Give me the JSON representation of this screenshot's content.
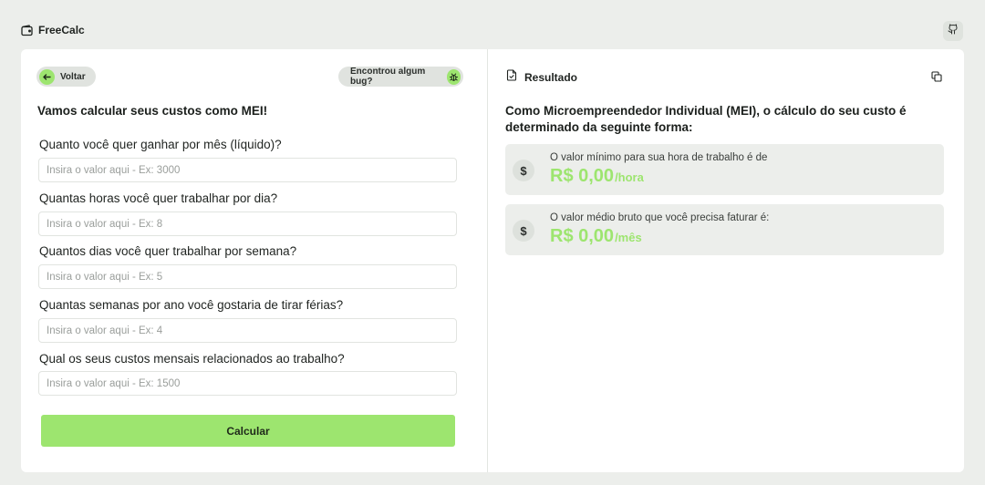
{
  "app": {
    "name": "FreeCalc"
  },
  "form": {
    "back_label": "Voltar",
    "bug_label": "Encontrou algum bug?",
    "title": "Vamos calcular seus custos como MEI!",
    "fields": [
      {
        "label": "Quanto você quer ganhar por mês (líquido)?",
        "placeholder": "Insira o valor aqui - Ex: 3000",
        "value": ""
      },
      {
        "label": "Quantas horas você quer trabalhar por dia?",
        "placeholder": "Insira o valor aqui - Ex: 8",
        "value": ""
      },
      {
        "label": "Quantos dias você quer trabalhar por semana?",
        "placeholder": "Insira o valor aqui - Ex: 5",
        "value": ""
      },
      {
        "label": "Quantas semanas por ano você gostaria de tirar férias?",
        "placeholder": "Insira o valor aqui - Ex: 4",
        "value": ""
      },
      {
        "label": "Qual os seus custos mensais relacionados ao trabalho?",
        "placeholder": "Insira o valor aqui - Ex: 1500",
        "value": ""
      }
    ],
    "submit_label": "Calcular"
  },
  "result": {
    "title": "Resultado",
    "description": "Como Microempreendedor Individual (MEI), o cálculo do seu custo é determinado da seguinte forma:",
    "cards": [
      {
        "icon": "dollar-icon",
        "label": "O valor mínimo para sua hora de trabalho é de",
        "amount": "R$ 0,00",
        "unit": "/hora"
      },
      {
        "icon": "dollar-icon",
        "label": "O valor médio bruto que você precisa faturar é:",
        "amount": "R$ 0,00",
        "unit": "/mês"
      }
    ]
  },
  "colors": {
    "accent": "#9de56f",
    "background": "#eceeeb",
    "card": "#ffffff",
    "pill": "#e0e3df"
  },
  "icons": {
    "brand": "wallet-icon",
    "github": "github-icon",
    "back": "arrow-left-icon",
    "bug": "bug-icon",
    "result": "file-check-icon",
    "copy": "copy-icon"
  }
}
